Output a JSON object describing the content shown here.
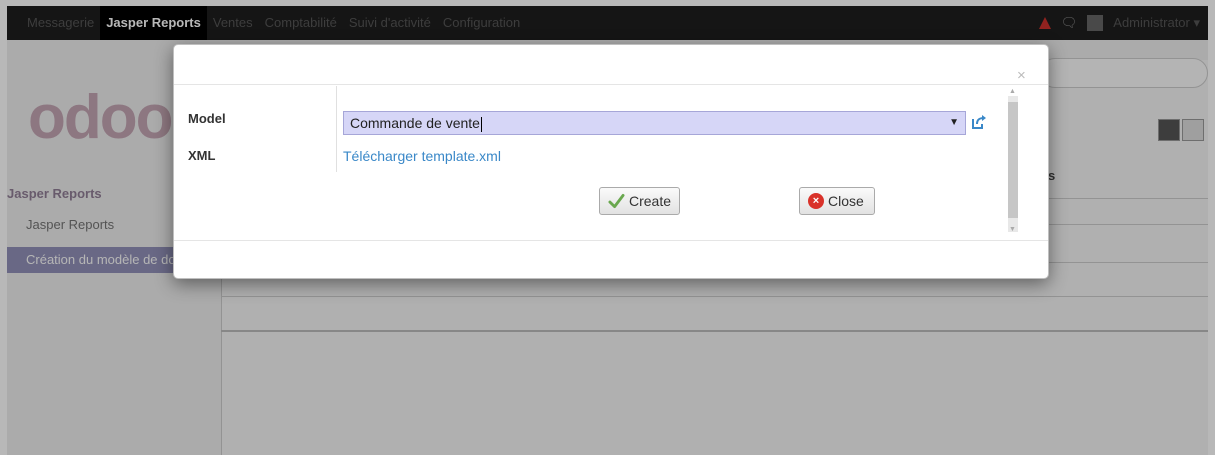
{
  "topbar": {
    "menu": [
      {
        "label": "Messagerie",
        "active": false
      },
      {
        "label": "Jasper Reports",
        "active": true
      },
      {
        "label": "Ventes",
        "active": false
      },
      {
        "label": "Comptabilité",
        "active": false
      },
      {
        "label": "Suivi d'activité",
        "active": false
      },
      {
        "label": "Configuration",
        "active": false
      }
    ],
    "user": "Administrator ▾"
  },
  "brand": {
    "logo_text": "odoo"
  },
  "sidebar": {
    "heading": "Jasper Reports",
    "items": [
      {
        "label": "Jasper Reports",
        "active": false
      },
      {
        "label": "Création du modèle de do",
        "active": true
      }
    ]
  },
  "list": {
    "partial_header": "s"
  },
  "dialog": {
    "close_glyph": "×",
    "fields": {
      "model_label": "Model",
      "model_value": "Commande de vente",
      "xml_label": "XML",
      "xml_link": "Télécharger template.xml"
    },
    "buttons": {
      "create_label": "Create",
      "close_label": "Close"
    }
  },
  "colors": {
    "accent": "#7c7bad",
    "select_bg": "#d6d6f7",
    "link": "#3a88c8",
    "danger": "#d9322a",
    "success": "#6aa84f"
  }
}
